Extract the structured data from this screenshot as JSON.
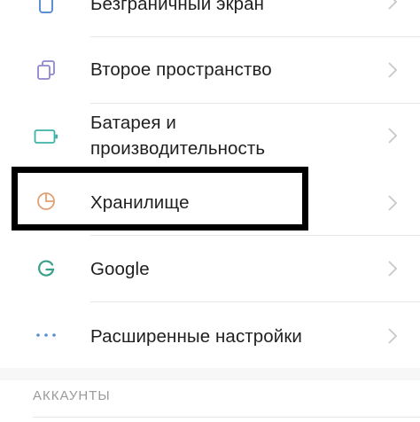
{
  "settings": {
    "items": [
      {
        "label": "Безграничный экран",
        "icon": "phone-outline-icon"
      },
      {
        "label": "Второе пространство",
        "icon": "dual-windows-icon"
      },
      {
        "label_line1": "Батарея и",
        "label_line2": "производительность",
        "icon": "battery-icon"
      },
      {
        "label": "Хранилище",
        "icon": "pie-chart-icon"
      },
      {
        "label": "Google",
        "icon": "google-g-icon"
      },
      {
        "label": "Расширенные настройки",
        "icon": "more-dots-icon"
      }
    ]
  },
  "accounts_section": {
    "title": "АККАУНТЫ"
  },
  "colors": {
    "icon_blue": "#5b8fd1",
    "icon_purple": "#8d86cf",
    "icon_teal": "#3cb3a6",
    "icon_orange": "#e0a074",
    "google_green": "#3aa088",
    "chevron": "#c8c8c8",
    "highlight_border": "#000000"
  }
}
